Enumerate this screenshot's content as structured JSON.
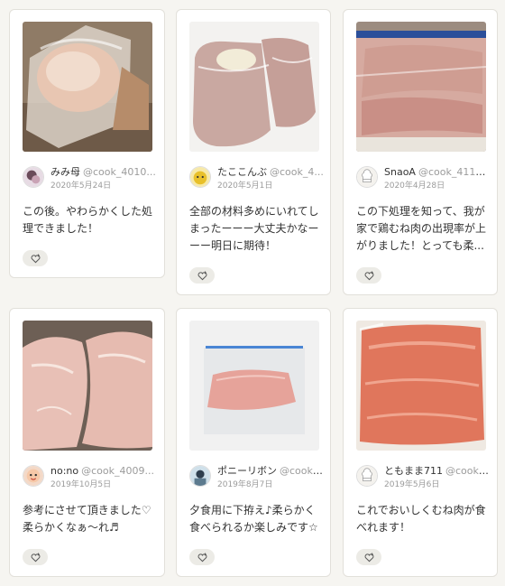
{
  "cards": [
    {
      "name": "みみ母",
      "id": "@cook_4010...",
      "date": "2020年5月24日",
      "comment": "この後。やわらかくした処理できました！"
    },
    {
      "name": "たここんぶ",
      "id": "@cook_4...",
      "date": "2020年5月1日",
      "comment": "全部の材料多めにいれてしまったーーー大丈夫かなーーー明日に期待！"
    },
    {
      "name": "SnaoA",
      "id": "@cook_4110...",
      "date": "2020年4月28日",
      "comment": "この下処理を知って、我が家で鶏むね肉の出現率が上がりました！とっても柔..."
    },
    {
      "name": "no:no",
      "id": "@cook_4009...",
      "date": "2019年10月5日",
      "comment": "参考にさせて頂きました♡柔らかくなぁ〜れ♬"
    },
    {
      "name": "ポニーリボン",
      "id": "@cook_...",
      "date": "2019年8月7日",
      "comment": "夕食用に下拵え♪柔らかく食べられるか楽しみです☆"
    },
    {
      "name": "ともまま711",
      "id": "@cook_...",
      "date": "2019年5月6日",
      "comment": "これでおいしくむね肉が食べれます！"
    }
  ],
  "icons": {
    "like": "heart-plus-icon",
    "default_avatar": "chef-hat-icon"
  },
  "colors": {
    "background": "#f6f5f1",
    "card": "#ffffff",
    "muted_text": "#9b9b9b",
    "like_button": "#ecebe6"
  }
}
